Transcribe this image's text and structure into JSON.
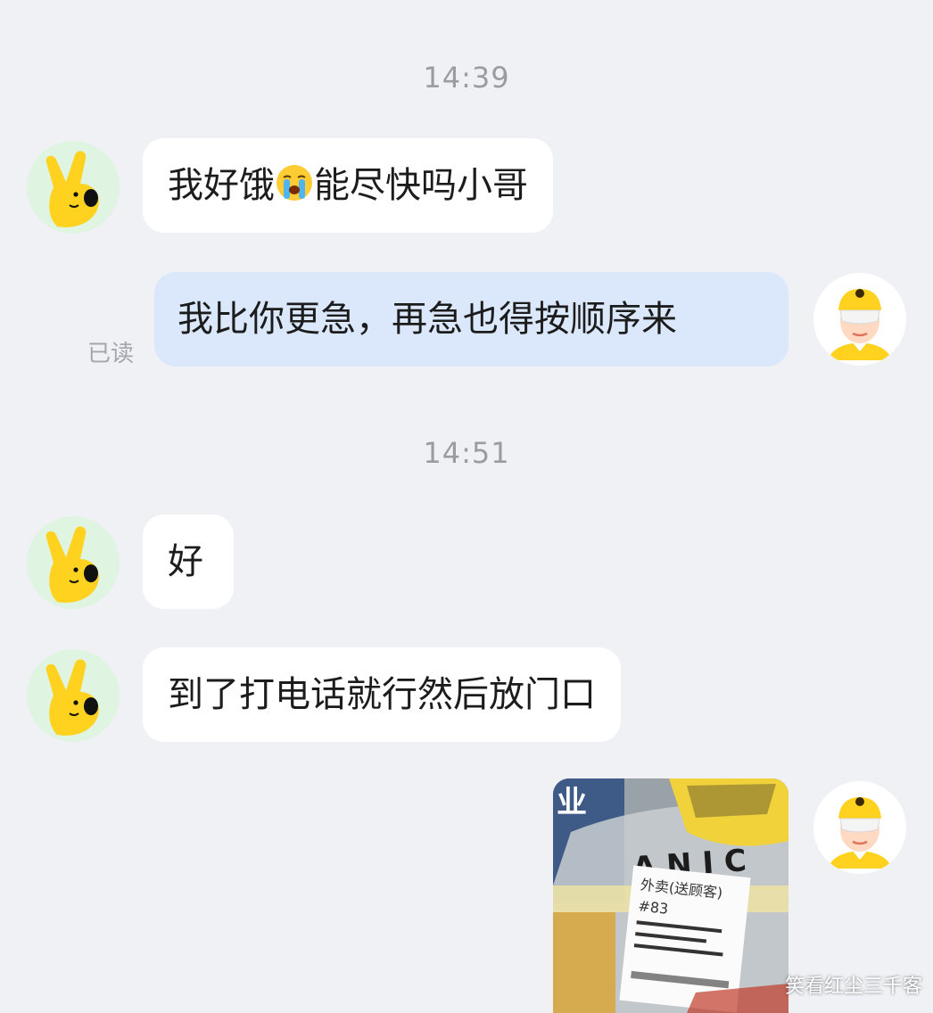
{
  "conversation": {
    "timestamps": [
      "14:39",
      "14:51"
    ],
    "messages": [
      {
        "side": "incoming",
        "sender": "customer",
        "text_before_emoji": "我好饿",
        "emoji": "crying-face-emoji",
        "text_after_emoji": "能尽快吗小哥"
      },
      {
        "side": "outgoing",
        "sender": "rider",
        "text": "我比你更急，再急也得按顺序来",
        "status": "已读"
      },
      {
        "side": "incoming",
        "sender": "customer",
        "text": "好"
      },
      {
        "side": "incoming",
        "sender": "customer",
        "text": "到了打电话就行然后放门口"
      },
      {
        "side": "outgoing",
        "sender": "rider",
        "type": "photo",
        "photo_text": [
          "业",
          "A N I C",
          "外卖(送顾客)",
          "#83"
        ]
      }
    ]
  },
  "watermark": "笑看红尘三千客",
  "colors": {
    "background": "#f0f1f5",
    "incoming_bubble": "#ffffff",
    "outgoing_bubble": "#dbe8fb",
    "customer_avatar_bg": "#dff4e1",
    "brand_yellow": "#ffd21f"
  }
}
